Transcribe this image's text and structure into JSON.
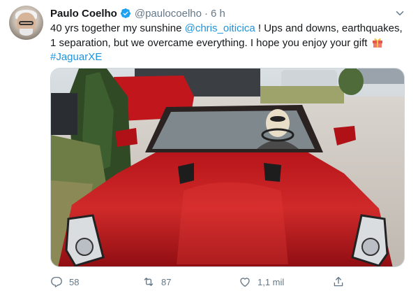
{
  "tweet": {
    "author_name": "Paulo Coelho",
    "handle": "@paulocoelho",
    "separator": "·",
    "time": "6 h",
    "text_part1": "40 yrs together my sunshine ",
    "mention": "@chris_oiticica",
    "text_part2": " ! Ups and downs, earthquakes, 1 separation, but we overcame everything. I hope you enjoy your gift ",
    "hashtag": "#JaguarXE",
    "media_description_icon": "photo-red-convertible",
    "reply_count": "58",
    "retweet_count": "87",
    "like_count": "1,1 mil"
  },
  "colors": {
    "link": "#1b95e0",
    "secondary_text": "#657786",
    "verified": "#1da1f2",
    "car_red": "#c3141b"
  },
  "icons": {
    "verified": "verified-badge-icon",
    "caret": "chevron-down-icon",
    "gift": "gift-emoji-icon",
    "reply": "reply-icon",
    "retweet": "retweet-icon",
    "like": "heart-icon",
    "share": "share-icon"
  }
}
